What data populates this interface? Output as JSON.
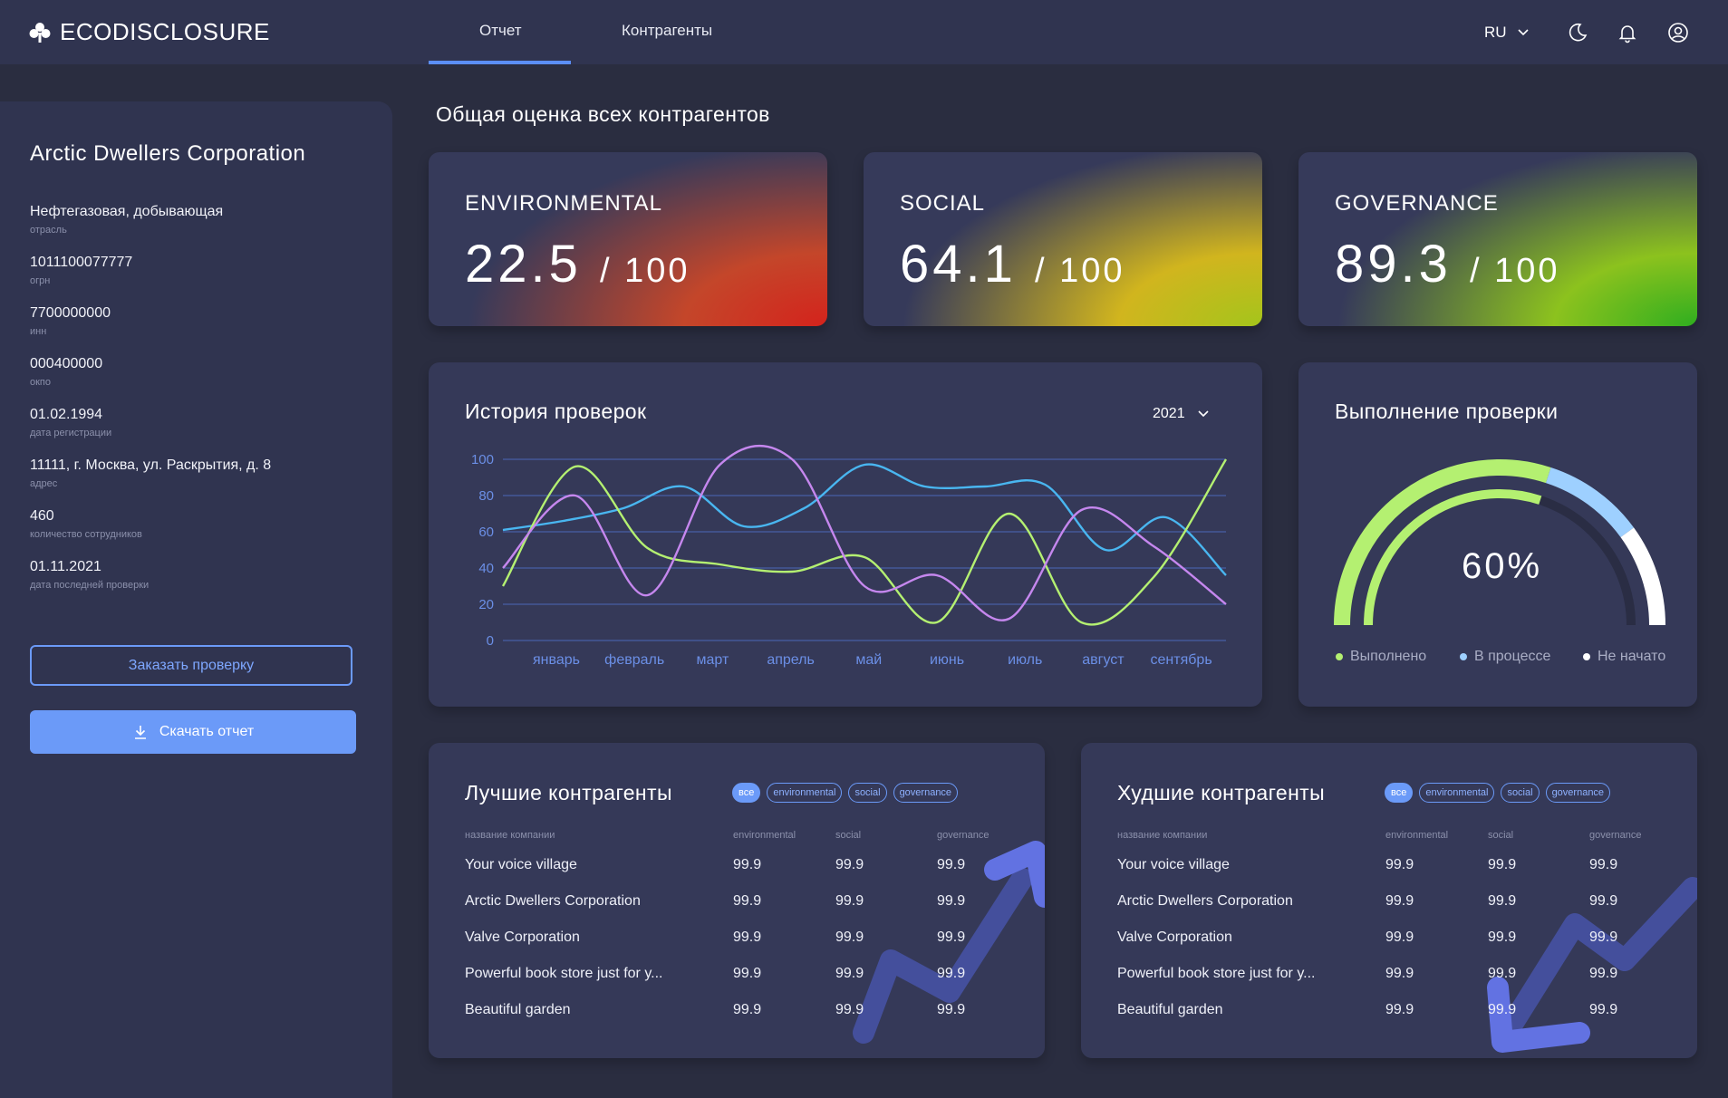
{
  "app": {
    "logo": "ECODISCLOSURE"
  },
  "nav": {
    "tabs": [
      "Отчет",
      "Контрагенты"
    ],
    "lang": "RU"
  },
  "company": {
    "name": "Arctic Dwellers Corporation",
    "fields": [
      {
        "value": "Нефтегазовая, добывающая",
        "label": "отрасль"
      },
      {
        "value": "1011100077777",
        "label": "огрн"
      },
      {
        "value": "7700000000",
        "label": "инн"
      },
      {
        "value": "000400000",
        "label": "окпо"
      },
      {
        "value": "01.02.1994",
        "label": "дата регистрации"
      },
      {
        "value": "11111, г. Москва, ул. Раскрытия, д. 8",
        "label": "адрес"
      },
      {
        "value": "460",
        "label": "количество сотрудников"
      },
      {
        "value": "01.11.2021",
        "label": "дата последней проверки"
      }
    ],
    "order_label": "Заказать проверку",
    "download_label": "Скачать отчет"
  },
  "overview": {
    "title": "Общая оценка всех контрагентов"
  },
  "scores": [
    {
      "name": "ENVIRONMENTAL",
      "value": "22.5",
      "max": "/ 100"
    },
    {
      "name": "SOCIAL",
      "value": "64.1",
      "max": "/ 100"
    },
    {
      "name": "GOVERNANCE",
      "value": "89.3",
      "max": "/ 100"
    }
  ],
  "history": {
    "title": "История проверок",
    "year": "2021"
  },
  "chart_data": {
    "type": "line",
    "categories": [
      "январь",
      "февраль",
      "март",
      "апрель",
      "май",
      "июнь",
      "июль",
      "август",
      "сентябрь"
    ],
    "yticks": [
      0,
      20,
      40,
      60,
      80,
      100
    ],
    "ylim": [
      0,
      100
    ],
    "series": [
      {
        "color": "#49b6f0",
        "values": [
          61,
          66,
          73,
          85,
          63,
          73,
          97,
          85,
          85,
          86,
          50,
          68,
          36
        ]
      },
      {
        "color": "#b4f071",
        "values": [
          30,
          96,
          51,
          42,
          38,
          46,
          10,
          70,
          10,
          35,
          100
        ]
      },
      {
        "color": "#c587ee",
        "values": [
          40,
          80,
          25,
          97,
          100,
          30,
          36,
          12,
          72,
          52,
          20
        ]
      }
    ]
  },
  "progress": {
    "title": "Выполнение проверки",
    "percent_label": "60%",
    "done": 0.6,
    "in_progress": 0.2,
    "not_started": 0.2,
    "legend": [
      {
        "label": "Выполнено",
        "color": "#b4f071"
      },
      {
        "label": "В процессе",
        "color": "#9ed0ff"
      },
      {
        "label": "Не начато",
        "color": "#ffffff"
      }
    ]
  },
  "best": {
    "title": "Лучшие контрагенты",
    "filters": [
      "все",
      "environmental",
      "social",
      "governance"
    ],
    "columns": [
      "название компании",
      "environmental",
      "social",
      "governance"
    ],
    "rows": [
      [
        "Your voice village",
        "99.9",
        "99.9",
        "99.9"
      ],
      [
        "Arctic Dwellers Corporation",
        "99.9",
        "99.9",
        "99.9"
      ],
      [
        "Valve Corporation",
        "99.9",
        "99.9",
        "99.9"
      ],
      [
        "Powerful book store just for y...",
        "99.9",
        "99.9",
        "99.9"
      ],
      [
        "Beautiful garden",
        "99.9",
        "99.9",
        "99.9"
      ]
    ]
  },
  "worst": {
    "title": "Худшие контрагенты",
    "filters": [
      "все",
      "environmental",
      "social",
      "governance"
    ],
    "columns": [
      "название компании",
      "environmental",
      "social",
      "governance"
    ],
    "rows": [
      [
        "Your voice village",
        "99.9",
        "99.9",
        "99.9"
      ],
      [
        "Arctic Dwellers Corporation",
        "99.9",
        "99.9",
        "99.9"
      ],
      [
        "Valve Corporation",
        "99.9",
        "99.9",
        "99.9"
      ],
      [
        "Powerful book store just for y...",
        "99.9",
        "99.9",
        "99.9"
      ],
      [
        "Beautiful garden",
        "99.9",
        "99.9",
        "99.9"
      ]
    ]
  }
}
